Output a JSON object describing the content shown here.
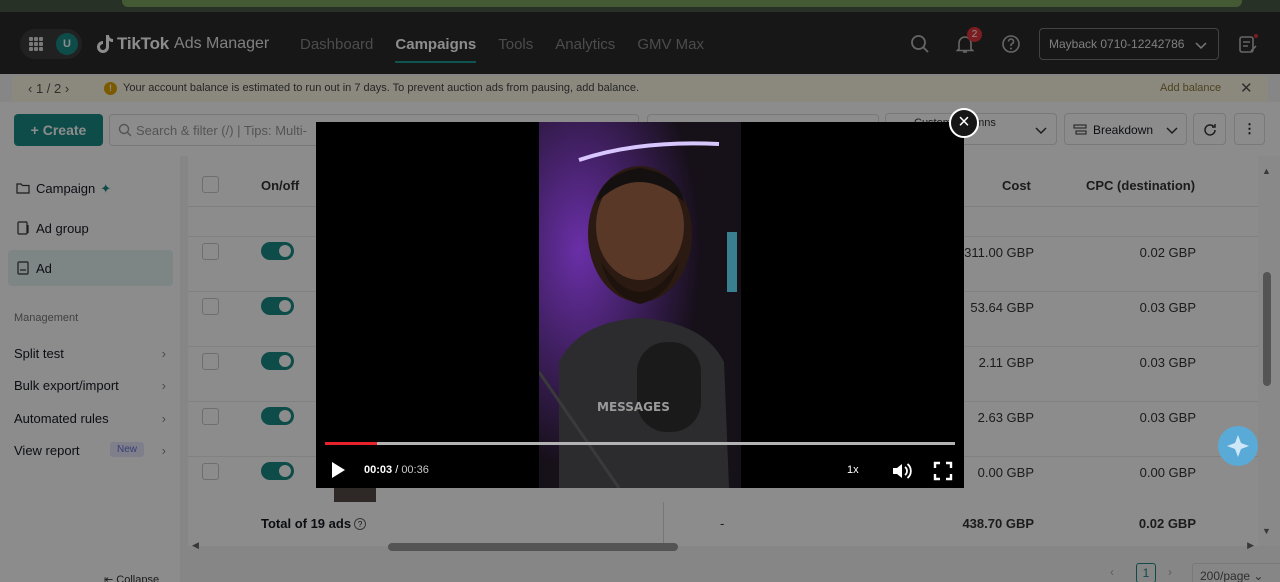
{
  "app": {
    "brand": "TikTok",
    "product": "Ads Manager",
    "avatar_letter": "U"
  },
  "nav": {
    "tabs": [
      {
        "label": "Dashboard"
      },
      {
        "label": "Campaigns"
      },
      {
        "label": "Tools"
      },
      {
        "label": "Analytics"
      },
      {
        "label": "GMV Max"
      }
    ],
    "notification_count": "2",
    "account": "Mayback 0710-12242786"
  },
  "notice": {
    "pager": "1 / 2",
    "message": "Your account balance is estimated to run out in 7 days. To prevent auction ads from pausing, add balance.",
    "action": "Add balance"
  },
  "toolbar": {
    "create_label": "Create",
    "search_placeholder": "Search & filter (/) | Tips: Multi-",
    "columns_line1": "Custom columns",
    "columns_line2": "columns",
    "breakdown_label": "Breakdown"
  },
  "sidebar": {
    "levels": [
      {
        "label": "Campaign"
      },
      {
        "label": "Ad group"
      },
      {
        "label": "Ad"
      }
    ],
    "section_title": "Management",
    "links": [
      {
        "label": "Split test"
      },
      {
        "label": "Bulk export/import"
      },
      {
        "label": "Automated rules"
      },
      {
        "label": "View report",
        "tag": "New"
      }
    ],
    "collapse_label": "Collapse"
  },
  "table": {
    "headers": {
      "onoff": "On/off",
      "cost": "Cost",
      "cpc": "CPC (destination)"
    },
    "rows": [
      {
        "cost": "311.00 GBP",
        "cpc": "0.02 GBP"
      },
      {
        "cost": "53.64 GBP",
        "cpc": "0.03 GBP"
      },
      {
        "cost": "2.11 GBP",
        "cpc": "0.03 GBP"
      },
      {
        "cost": "2.63 GBP",
        "cpc": "0.03 GBP"
      },
      {
        "cost": "0.00 GBP",
        "cpc": "0.00 GBP"
      }
    ],
    "total": {
      "label": "Total of 19 ads",
      "dash": "-",
      "cost": "438.70 GBP",
      "cpc": "0.02 GBP"
    }
  },
  "pagination": {
    "page": "1",
    "page_size": "200/page"
  },
  "video": {
    "current_time": "00:03",
    "duration": "00:36",
    "speed": "1x",
    "progress": 0.083,
    "caption_in_video": "MESSAGES"
  },
  "colors": {
    "accent": "#1b8a86",
    "progress": "#e8222a",
    "nav_bg": "#2b2b2b"
  }
}
